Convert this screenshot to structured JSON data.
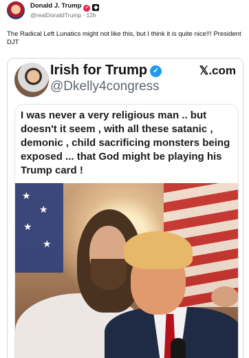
{
  "post": {
    "author": "Donald J. Trump",
    "handle": "@realDonaldTrump",
    "time": "12h",
    "text": "The Radical Left Lunatics might not like this, but I think it is quite nice!!! President DJT"
  },
  "card": {
    "name": "Irish for Trump",
    "handle": "@Dkelly4congress",
    "site": "𝕏.com",
    "quote": "I was never a very religious man .. but doesn't it seem , with all these satanic , demonic , child sacrificing monsters being exposed ... that God might be playing his Trump card !"
  },
  "icons": {
    "verified_red": "verified-badge-icon",
    "affiliate": "affiliate-badge-icon",
    "verified_blue": "verified-checkmark-icon"
  },
  "colors": {
    "verified_blue": "#1d9bf0",
    "verified_red": "#e3264a",
    "handle_gray": "#6b6b6b"
  }
}
